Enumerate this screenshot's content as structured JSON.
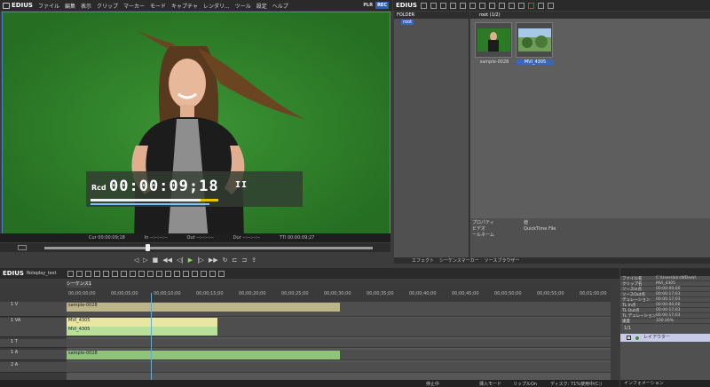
{
  "app": {
    "name": "EDIUS"
  },
  "menu": [
    "ファイル",
    "編集",
    "表示",
    "クリップ",
    "マーカー",
    "モード",
    "キャプチャ",
    "レンダリ...",
    "ツール",
    "設定",
    "ヘルプ"
  ],
  "plr": {
    "plr": "PLR",
    "rec": "REC"
  },
  "preview": {
    "rcd_label": "Rcd",
    "timecode": "00:00:09;18",
    "timecode_flag": "II",
    "cur": "Cur 00:00:09;18",
    "in": "In --:--:--:--",
    "out": "Out --:--:--:--",
    "dur": "Dur --:--:--:--",
    "ttl": "TTl 00:00:09;27"
  },
  "folder": {
    "header": "FOLDER",
    "root": "root"
  },
  "bin": {
    "header": "root (1/2)",
    "clips": [
      {
        "name": "sample-0028"
      },
      {
        "name": "MVI_4305"
      }
    ]
  },
  "properties": [
    {
      "k": "プロパティ",
      "v": "値"
    },
    {
      "k": "ビデオ",
      "v": "QuickTime File"
    },
    {
      "k": "ールネーム",
      "v": ""
    }
  ],
  "bin_tabs": [
    "エフェクト",
    "シーケンスマーカー",
    "ソースブラウザー"
  ],
  "timeline": {
    "project": "Roleplay_test",
    "sequence_tab": "シーケンス1",
    "ruler": [
      "00;00;00;00",
      "00;00;05;00",
      "00;00;10;00",
      "00;00;15;00",
      "00;00;20;00",
      "00;00;25;00",
      "00;00;30;00",
      "00;00;35;00",
      "00;00;40;00",
      "00;00;45;00",
      "00;00;50;00",
      "00;00;55;00",
      "00;01;00;00"
    ],
    "tracks": [
      "1 V",
      "1 VA",
      "1 T",
      "1 A",
      "2 A"
    ],
    "clips": {
      "v": "sample-0028",
      "va_top": "MVI_4305",
      "va_bottom": "MVI_4305",
      "a": "sample-0028"
    }
  },
  "status": {
    "stop": "停止中",
    "insert": "挿入モード",
    "ripple": "リップルOn",
    "disk": "ディスク: 71%使用中(C:)"
  },
  "info": {
    "page": "1/1",
    "rows": [
      {
        "k": "ファイル名",
        "v": "C:\\Users\\kirsWDesk\\"
      },
      {
        "k": "クリップ名",
        "v": "MVI_4305"
      },
      {
        "k": "ソースIn点",
        "v": "00:00:00;00"
      },
      {
        "k": "ソースOut点",
        "v": "00:00:17;03"
      },
      {
        "k": "デュレーション",
        "v": "00:00:17;03"
      },
      {
        "k": "TL In点",
        "v": "00:00:00;00"
      },
      {
        "k": "TL Out点",
        "v": "00:00:17;03"
      },
      {
        "k": "TL デュレーション",
        "v": "00:00:17;03"
      },
      {
        "k": "速度",
        "v": "100.00%"
      }
    ],
    "layer": "レイアウター",
    "tab": "インフォメーション"
  }
}
